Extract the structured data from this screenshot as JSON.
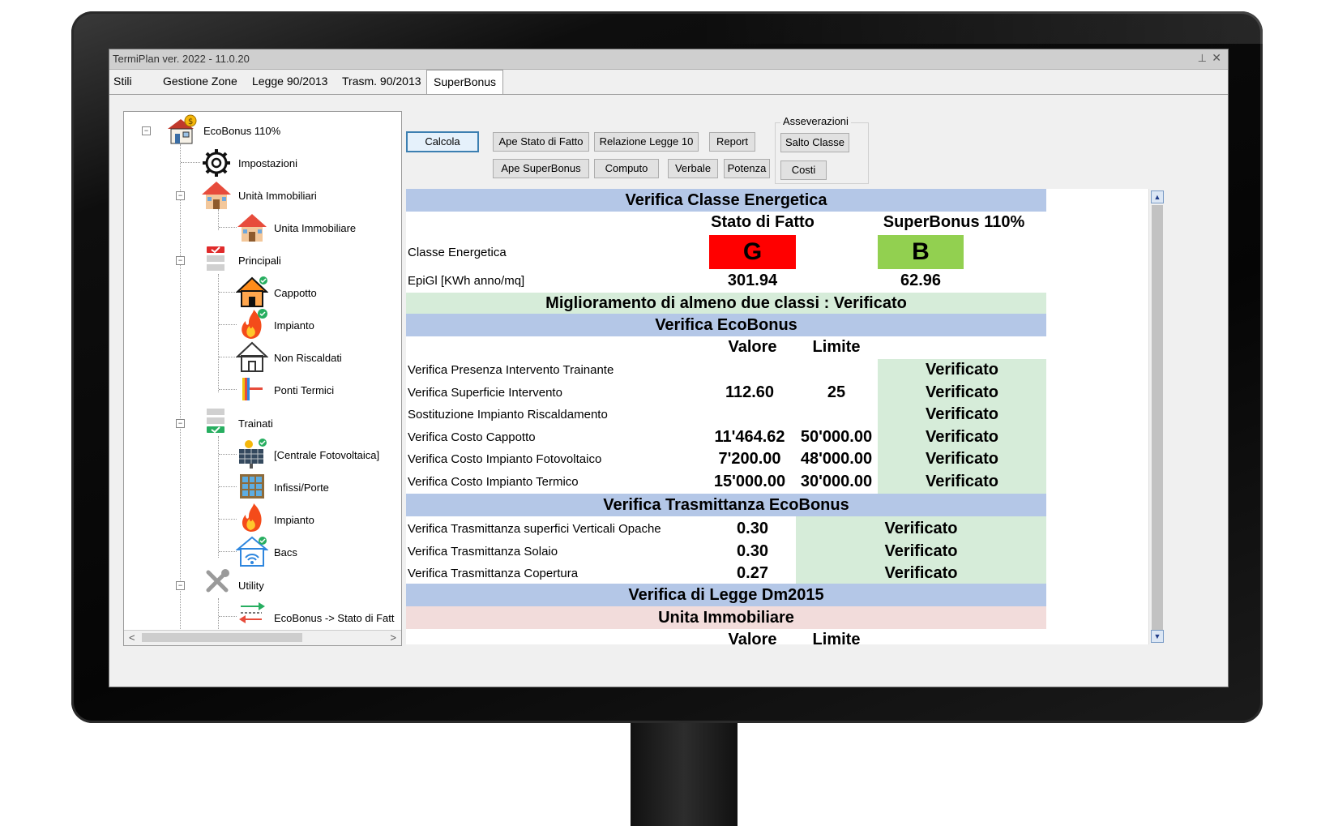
{
  "window": {
    "title": "TermiPlan ver. 2022 - 11.0.20",
    "pin_glyph": "⊥",
    "close_glyph": "✕"
  },
  "tabs": [
    {
      "label": "Stili"
    },
    {
      "label": "Gestione Zone"
    },
    {
      "label": "Legge 90/2013"
    },
    {
      "label": "Trasm. 90/2013"
    },
    {
      "label": "SuperBonus",
      "active": true
    }
  ],
  "tree": {
    "root": "EcoBonus 110%",
    "items": [
      {
        "label": "Impostazioni",
        "icon": "gear-icon"
      },
      {
        "label": "Unità Immobiliari",
        "icon": "house-icon"
      },
      {
        "label": "Unita Immobiliare",
        "icon": "house-icon"
      },
      {
        "label": "Principali",
        "icon": "checklist-icon"
      },
      {
        "label": "Cappotto",
        "icon": "house-insulation-icon"
      },
      {
        "label": "Impianto",
        "icon": "flame-check-icon"
      },
      {
        "label": "Non Riscaldati",
        "icon": "house-outline-icon"
      },
      {
        "label": "Ponti Termici",
        "icon": "thermal-bridge-icon"
      },
      {
        "label": "Trainati",
        "icon": "checklist-icon"
      },
      {
        "label": "[Centrale Fotovoltaica]",
        "icon": "solar-panel-icon"
      },
      {
        "label": "Infissi/Porte",
        "icon": "window-icon"
      },
      {
        "label": "Impianto",
        "icon": "flame-icon"
      },
      {
        "label": "Bacs",
        "icon": "wifi-house-icon"
      },
      {
        "label": "Utility",
        "icon": "tools-icon"
      },
      {
        "label": "EcoBonus -> Stato di Fatt",
        "icon": "arrow-icon"
      }
    ],
    "scroll_left": "<",
    "scroll_right": ">"
  },
  "toolbar": {
    "calcola": "Calcola",
    "ape_stato": "Ape Stato di Fatto",
    "relazione": "Relazione Legge 10",
    "report": "Report",
    "ape_superbonus": "Ape SuperBonus",
    "computo": "Computo",
    "verbale": "Verbale",
    "potenza": "Potenza",
    "asseverazioni_title": "Asseverazioni",
    "salto_classe": "Salto Classe",
    "costi": "Costi"
  },
  "report": {
    "classe_header": "Verifica Classe Energetica",
    "col_stato": "Stato di Fatto",
    "col_superbonus": "SuperBonus 110%",
    "classe_label": "Classe Energetica",
    "classe_stato": "G",
    "classe_stato_color": "#ff0000",
    "classe_super": "B",
    "classe_super_color": "#92d050",
    "epigl_label": "EpiGl [KWh anno/mq]",
    "epigl_stato": "301.94",
    "epigl_super": "62.96",
    "miglioramento": "Miglioramento di almeno due classi : Verificato",
    "ecobonus_header": "Verifica EcoBonus",
    "col_valore": "Valore",
    "col_limite": "Limite",
    "eco_rows": [
      {
        "label": "Verifica Presenza Intervento Trainante",
        "valore": "",
        "limite": "",
        "esito": "Verificato"
      },
      {
        "label": "Verifica Superficie Intervento",
        "valore": "112.60",
        "limite": "25",
        "esito": "Verificato"
      },
      {
        "label": "Sostituzione Impianto Riscaldamento",
        "valore": "",
        "limite": "",
        "esito": "Verificato"
      },
      {
        "label": "Verifica Costo Cappotto",
        "valore": "11'464.62",
        "limite": "50'000.00",
        "esito": "Verificato"
      },
      {
        "label": "Verifica Costo Impianto Fotovoltaico",
        "valore": "7'200.00",
        "limite": "48'000.00",
        "esito": "Verificato"
      },
      {
        "label": "Verifica Costo Impianto Termico",
        "valore": "15'000.00",
        "limite": "30'000.00",
        "esito": "Verificato"
      }
    ],
    "trasm_header": "Verifica Trasmittanza EcoBonus",
    "trasm_rows": [
      {
        "label": "Verifica Trasmittanza superfici Verticali Opache",
        "valore": "0.30",
        "esito": "Verificato"
      },
      {
        "label": "Verifica Trasmittanza Solaio",
        "valore": "0.30",
        "esito": "Verificato"
      },
      {
        "label": "Verifica Trasmittanza Copertura",
        "valore": "0.27",
        "esito": "Verificato"
      }
    ],
    "dm_header": "Verifica di Legge Dm2015",
    "unita_header": "Unita Immobiliare",
    "unita_valore": "Valore",
    "unita_limite": "Limite"
  },
  "colors": {
    "header_blue": "#b4c7e7",
    "ok_green": "#d6ecd9",
    "unit_pink": "#f2dcdb"
  }
}
